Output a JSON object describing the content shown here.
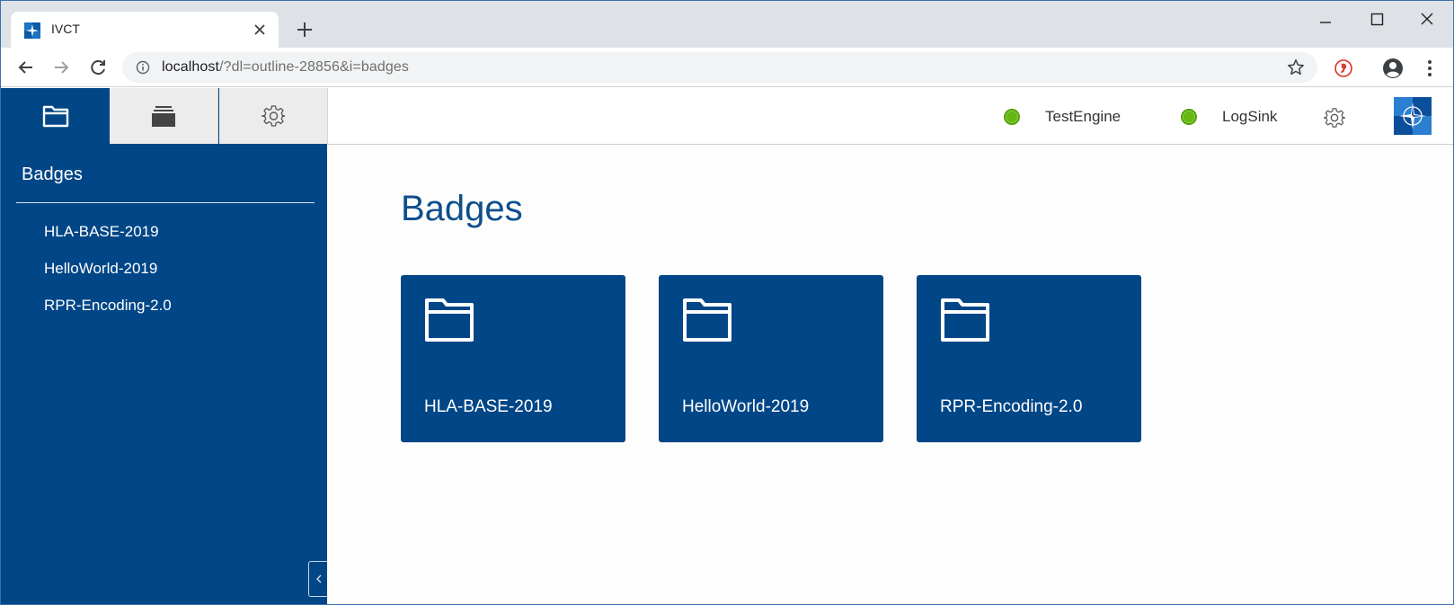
{
  "browser": {
    "tab_title": "IVCT",
    "url_host": "localhost",
    "url_path": "/?dl=outline-28856&i=badges"
  },
  "sidebar": {
    "tabs": [
      {
        "icon": "folder-icon",
        "active": true
      },
      {
        "icon": "stack-icon",
        "active": false
      },
      {
        "icon": "gear-icon",
        "active": false
      }
    ],
    "title": "Badges",
    "items": [
      "HLA-BASE-2019",
      "HelloWorld-2019",
      "RPR-Encoding-2.0"
    ]
  },
  "topbar": {
    "statuses": [
      {
        "label": "TestEngine",
        "color": "#65b714"
      },
      {
        "label": "LogSink",
        "color": "#65b714"
      }
    ]
  },
  "main": {
    "title": "Badges",
    "cards": [
      {
        "label": "HLA-BASE-2019",
        "icon": "folder-icon"
      },
      {
        "label": "HelloWorld-2019",
        "icon": "folder-icon"
      },
      {
        "label": "RPR-Encoding-2.0",
        "icon": "folder-icon"
      }
    ]
  },
  "colors": {
    "brand_blue": "#014686",
    "title_blue": "#0e4f8b",
    "status_green": "#65b714"
  }
}
